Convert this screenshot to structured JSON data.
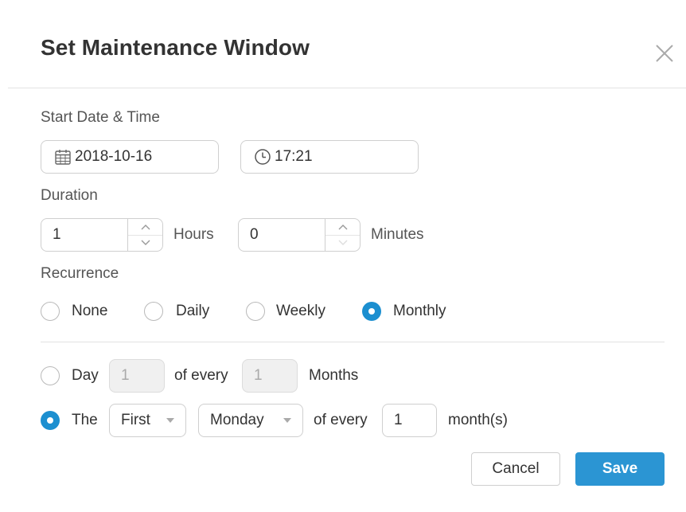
{
  "dialog": {
    "title": "Set Maintenance Window",
    "close_icon": "close-icon"
  },
  "start": {
    "label": "Start Date & Time",
    "date_value": "2018-10-16",
    "date_icon": "calendar-icon",
    "time_value": "17:21",
    "time_icon": "clock-icon"
  },
  "duration": {
    "label": "Duration",
    "hours_value": "1",
    "hours_unit": "Hours",
    "minutes_value": "0",
    "minutes_unit": "Minutes"
  },
  "recurrence": {
    "label": "Recurrence",
    "options": [
      {
        "label": "None",
        "selected": false
      },
      {
        "label": "Daily",
        "selected": false
      },
      {
        "label": "Weekly",
        "selected": false
      },
      {
        "label": "Monthly",
        "selected": true
      }
    ]
  },
  "monthly": {
    "day_option": {
      "label": "Day",
      "day_value": "1",
      "of_every": "of every",
      "months_value": "1",
      "months_unit": "Months",
      "selected": false
    },
    "the_option": {
      "label": "The",
      "ordinal": "First",
      "weekday": "Monday",
      "of_every": "of every",
      "months_value": "1",
      "months_unit": "month(s)",
      "selected": true
    }
  },
  "actions": {
    "cancel_label": "Cancel",
    "save_label": "Save"
  },
  "colors": {
    "accent": "#2b95d3",
    "radio_selected": "#1c8fd0"
  }
}
